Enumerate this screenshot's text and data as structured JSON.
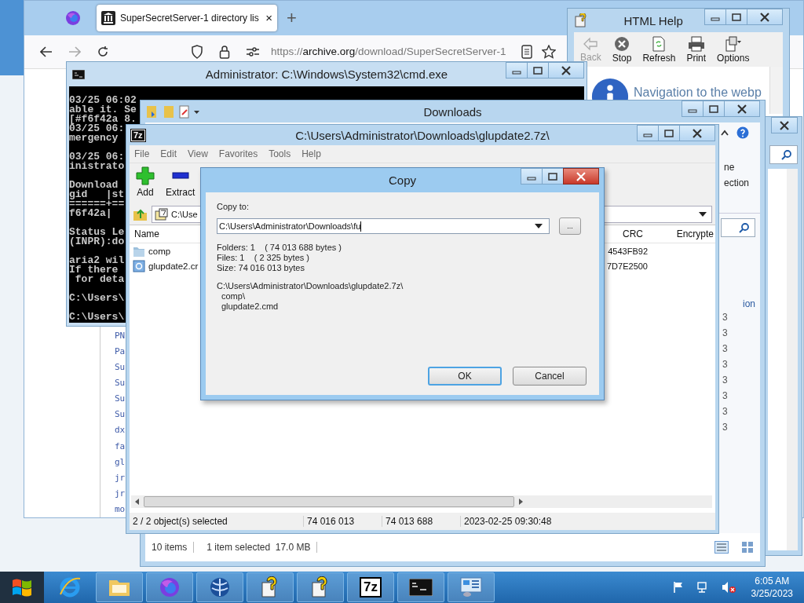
{
  "browser": {
    "tab": {
      "title": "SuperSecretServer-1 directory lis",
      "close": "×"
    },
    "new_tab": "+",
    "url": {
      "scheme": "https://",
      "domain": "archive.org",
      "path": "/download/SuperSecretServer-1"
    },
    "links": [
      "PN",
      "Pa",
      "Su",
      "Su",
      "Su",
      "Su",
      "dx",
      "fa",
      "gl",
      "jr",
      "jr",
      "mo"
    ]
  },
  "html_help": {
    "title": "HTML Help",
    "toolbar": [
      {
        "label": "Back",
        "kind": "back",
        "disabled": true
      },
      {
        "label": "Stop",
        "kind": "stop",
        "disabled": false
      },
      {
        "label": "Refresh",
        "kind": "refresh",
        "disabled": false
      },
      {
        "label": "Print",
        "kind": "print",
        "disabled": false
      },
      {
        "label": "Options",
        "kind": "options",
        "disabled": false
      }
    ],
    "message": "Navigation to the webp"
  },
  "downloads": {
    "title": "Downloads",
    "ribbon": [
      "ne",
      "ection"
    ],
    "side_link": "ion",
    "sizes": [
      "3",
      "3",
      "3",
      "3",
      "3",
      "3",
      "3",
      "3"
    ],
    "status": [
      "10 items",
      "1 item selected  17.0 MB"
    ]
  },
  "cmd": {
    "title": "Administrator: C:\\Windows\\System32\\cmd.exe",
    "blocks": [
      [
        "03/25 06:02",
        "able it. Se",
        "[#f6f42a 8.",
        "03/25 06:",
        "mergency"
      ],
      [
        "03/25 06:",
        "inistrato"
      ],
      [
        "Download",
        "gid   |st",
        "======+==",
        "f6f42a|"
      ],
      [
        "Status Le",
        "(INPR):do"
      ],
      [
        "aria2 wil",
        "If there",
        " for deta"
      ],
      [
        "C:\\Users\\"
      ],
      [
        "C:\\Users\\"
      ]
    ]
  },
  "archive": {
    "icon": "7z",
    "title": "C:\\Users\\Administrator\\Downloads\\glupdate2.7z\\",
    "menu": [
      "File",
      "Edit",
      "View",
      "Favorites",
      "Tools",
      "Help"
    ],
    "toolbar": [
      {
        "label": "Add",
        "kind": "add"
      },
      {
        "label": "Extract",
        "kind": "extract"
      }
    ],
    "path": "C:\\Use",
    "columns": [
      "Name",
      "CRC",
      "Encrypte"
    ],
    "rows": [
      {
        "name": "comp",
        "kind": "folder",
        "crc": "4543FB92"
      },
      {
        "name": "glupdate2.cr",
        "kind": "script",
        "crc": "7D7E2500"
      }
    ],
    "status": [
      "2 / 2 object(s) selected",
      "74 016 013",
      "74 013 688",
      "2023-02-25 09:30:48"
    ]
  },
  "copy_dialog": {
    "title": "Copy",
    "label": "Copy to:",
    "value": "C:\\Users\\Administrator\\Downloads\\fu",
    "browse": "...",
    "summary": [
      "Folders: 1    ( 74 013 688 bytes )",
      "Files: 1    ( 2 325 bytes )",
      "Size: 74 016 013 bytes"
    ],
    "source": "C:\\Users\\Administrator\\Downloads\\glupdate2.7z\\",
    "items": [
      "comp\\",
      "glupdate2.cmd"
    ],
    "buttons": [
      {
        "label": "OK",
        "default": true
      },
      {
        "label": "Cancel",
        "default": false
      }
    ]
  },
  "taskbar": {
    "apps": [
      {
        "kind": "ie"
      },
      {
        "kind": "folder"
      },
      {
        "kind": "firefox"
      },
      {
        "kind": "globe"
      },
      {
        "kind": "help"
      },
      {
        "kind": "help"
      },
      {
        "kind": "archiver",
        "glyph": "7z"
      },
      {
        "kind": "console"
      },
      {
        "kind": "panel"
      }
    ],
    "clock": {
      "time": "6:05 AM",
      "date": "3/25/2023"
    }
  }
}
